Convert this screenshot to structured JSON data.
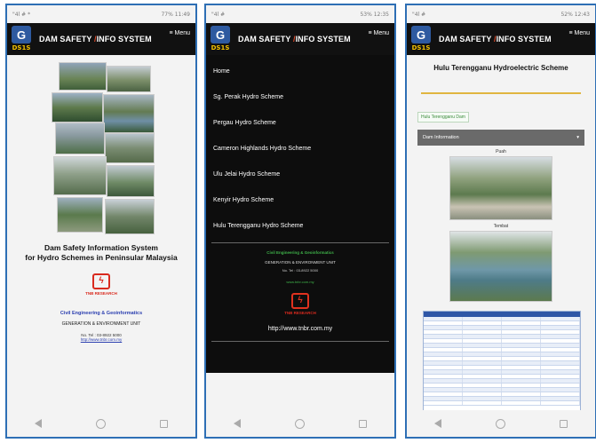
{
  "screens": [
    {
      "status": {
        "left": "\"4l # *",
        "right": "77% 11:49"
      },
      "app": {
        "title_a": "DAM SAFETY ",
        "title_b": "/",
        "title_c": "INFO SYSTEM",
        "menu": "≡ Menu",
        "logo": "DS1S"
      },
      "main": {
        "heading_line1": "Dam Safety Information System",
        "heading_line2": "for Hydro Schemes in Peninsular Malaysia",
        "tnb": "TNB RESEARCH",
        "civil": "Civil Engineering & Geoinformatics",
        "generation": "GENERATION & ENVIRONMENT UNIT",
        "tel": "No. Tel : 03-8922 5000",
        "url": "http://www.tnbr.com.my"
      }
    },
    {
      "status": {
        "left": "\"4l #",
        "right": "53% 12:35"
      },
      "app": {
        "title_a": "DAM SAFETY ",
        "title_b": "/",
        "title_c": "INFO SYSTEM",
        "menu": "≡ Menu",
        "logo": "DS1S"
      },
      "menu_items": [
        "Home",
        "Sg. Perak Hydro Scheme",
        "Pergau Hydro Scheme",
        "Cameron Highlands Hydro Scheme",
        "Ulu Jelai Hydro Scheme",
        "Kenyir Hydro Scheme",
        "Hulu Terengganu Hydro Scheme"
      ],
      "footer": {
        "civil": "Civil Engineering & Geoinformatics",
        "generation": "GENERATION & ENVIRONMENT UNIT",
        "tel": "No. Tel : 03-8922 5000",
        "link": "www.tnbr.com.my",
        "tnb": "TNB RESEARCH",
        "url": "http://www.tnbr.com.my"
      }
    },
    {
      "status": {
        "left": "\"4l #",
        "right": "52% 12:43"
      },
      "app": {
        "title_a": "DAM SAFETY ",
        "title_b": "/",
        "title_c": "INFO SYSTEM",
        "menu": "≡ Menu",
        "logo": "DS1S"
      },
      "main": {
        "title": "Hulu Terengganu Hydroelectric Scheme",
        "chip": "Hulu Terengganu Dam",
        "accordion": "Dam Information",
        "photo1_label": "Puah",
        "photo2_label": "Tembat"
      }
    }
  ],
  "colors": {
    "border": "#2e6fb5",
    "appbar": "#111111",
    "accent": "#f5c400",
    "menu_bg": "#0d0d0d",
    "link_green": "#3fb44a",
    "table_header": "#2e56a6"
  }
}
